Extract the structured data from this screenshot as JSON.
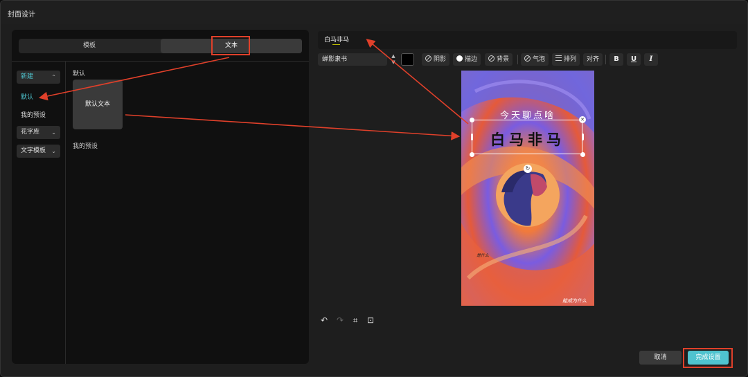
{
  "window": {
    "title": "封面设计"
  },
  "tabs": [
    {
      "label": "模板"
    },
    {
      "label": "文本"
    }
  ],
  "categories": {
    "new": {
      "label": "新建",
      "expanded": true
    },
    "sub_items": [
      {
        "label": "默认",
        "active": true
      },
      {
        "label": "我的预设",
        "active": false
      }
    ],
    "fancy_text": {
      "label": "花字库"
    },
    "text_template": {
      "label": "文字模板"
    }
  },
  "content": {
    "section_default": "默认",
    "preset_card_label": "默认文本",
    "section_my_presets": "我的预设"
  },
  "editor": {
    "text_value": "白马非马",
    "font": "蝉影隶书",
    "text_color": "#000000",
    "buttons": {
      "shadow": "阴影",
      "stroke": "描边",
      "background": "背景",
      "bubble": "气泡",
      "arrange": "排列",
      "align": "对齐"
    },
    "format": {
      "bold": "B",
      "underline": "U",
      "italic": "I"
    }
  },
  "canvas": {
    "subtitle": "今天聊点啥",
    "main_text": "白马非马",
    "sig_left": "是什么",
    "sig_right": "能成为什么"
  },
  "footer": {
    "cancel": "取消",
    "done": "完成设置"
  },
  "colors": {
    "accent": "#4fc3cf",
    "annotation": "#e0402a"
  }
}
